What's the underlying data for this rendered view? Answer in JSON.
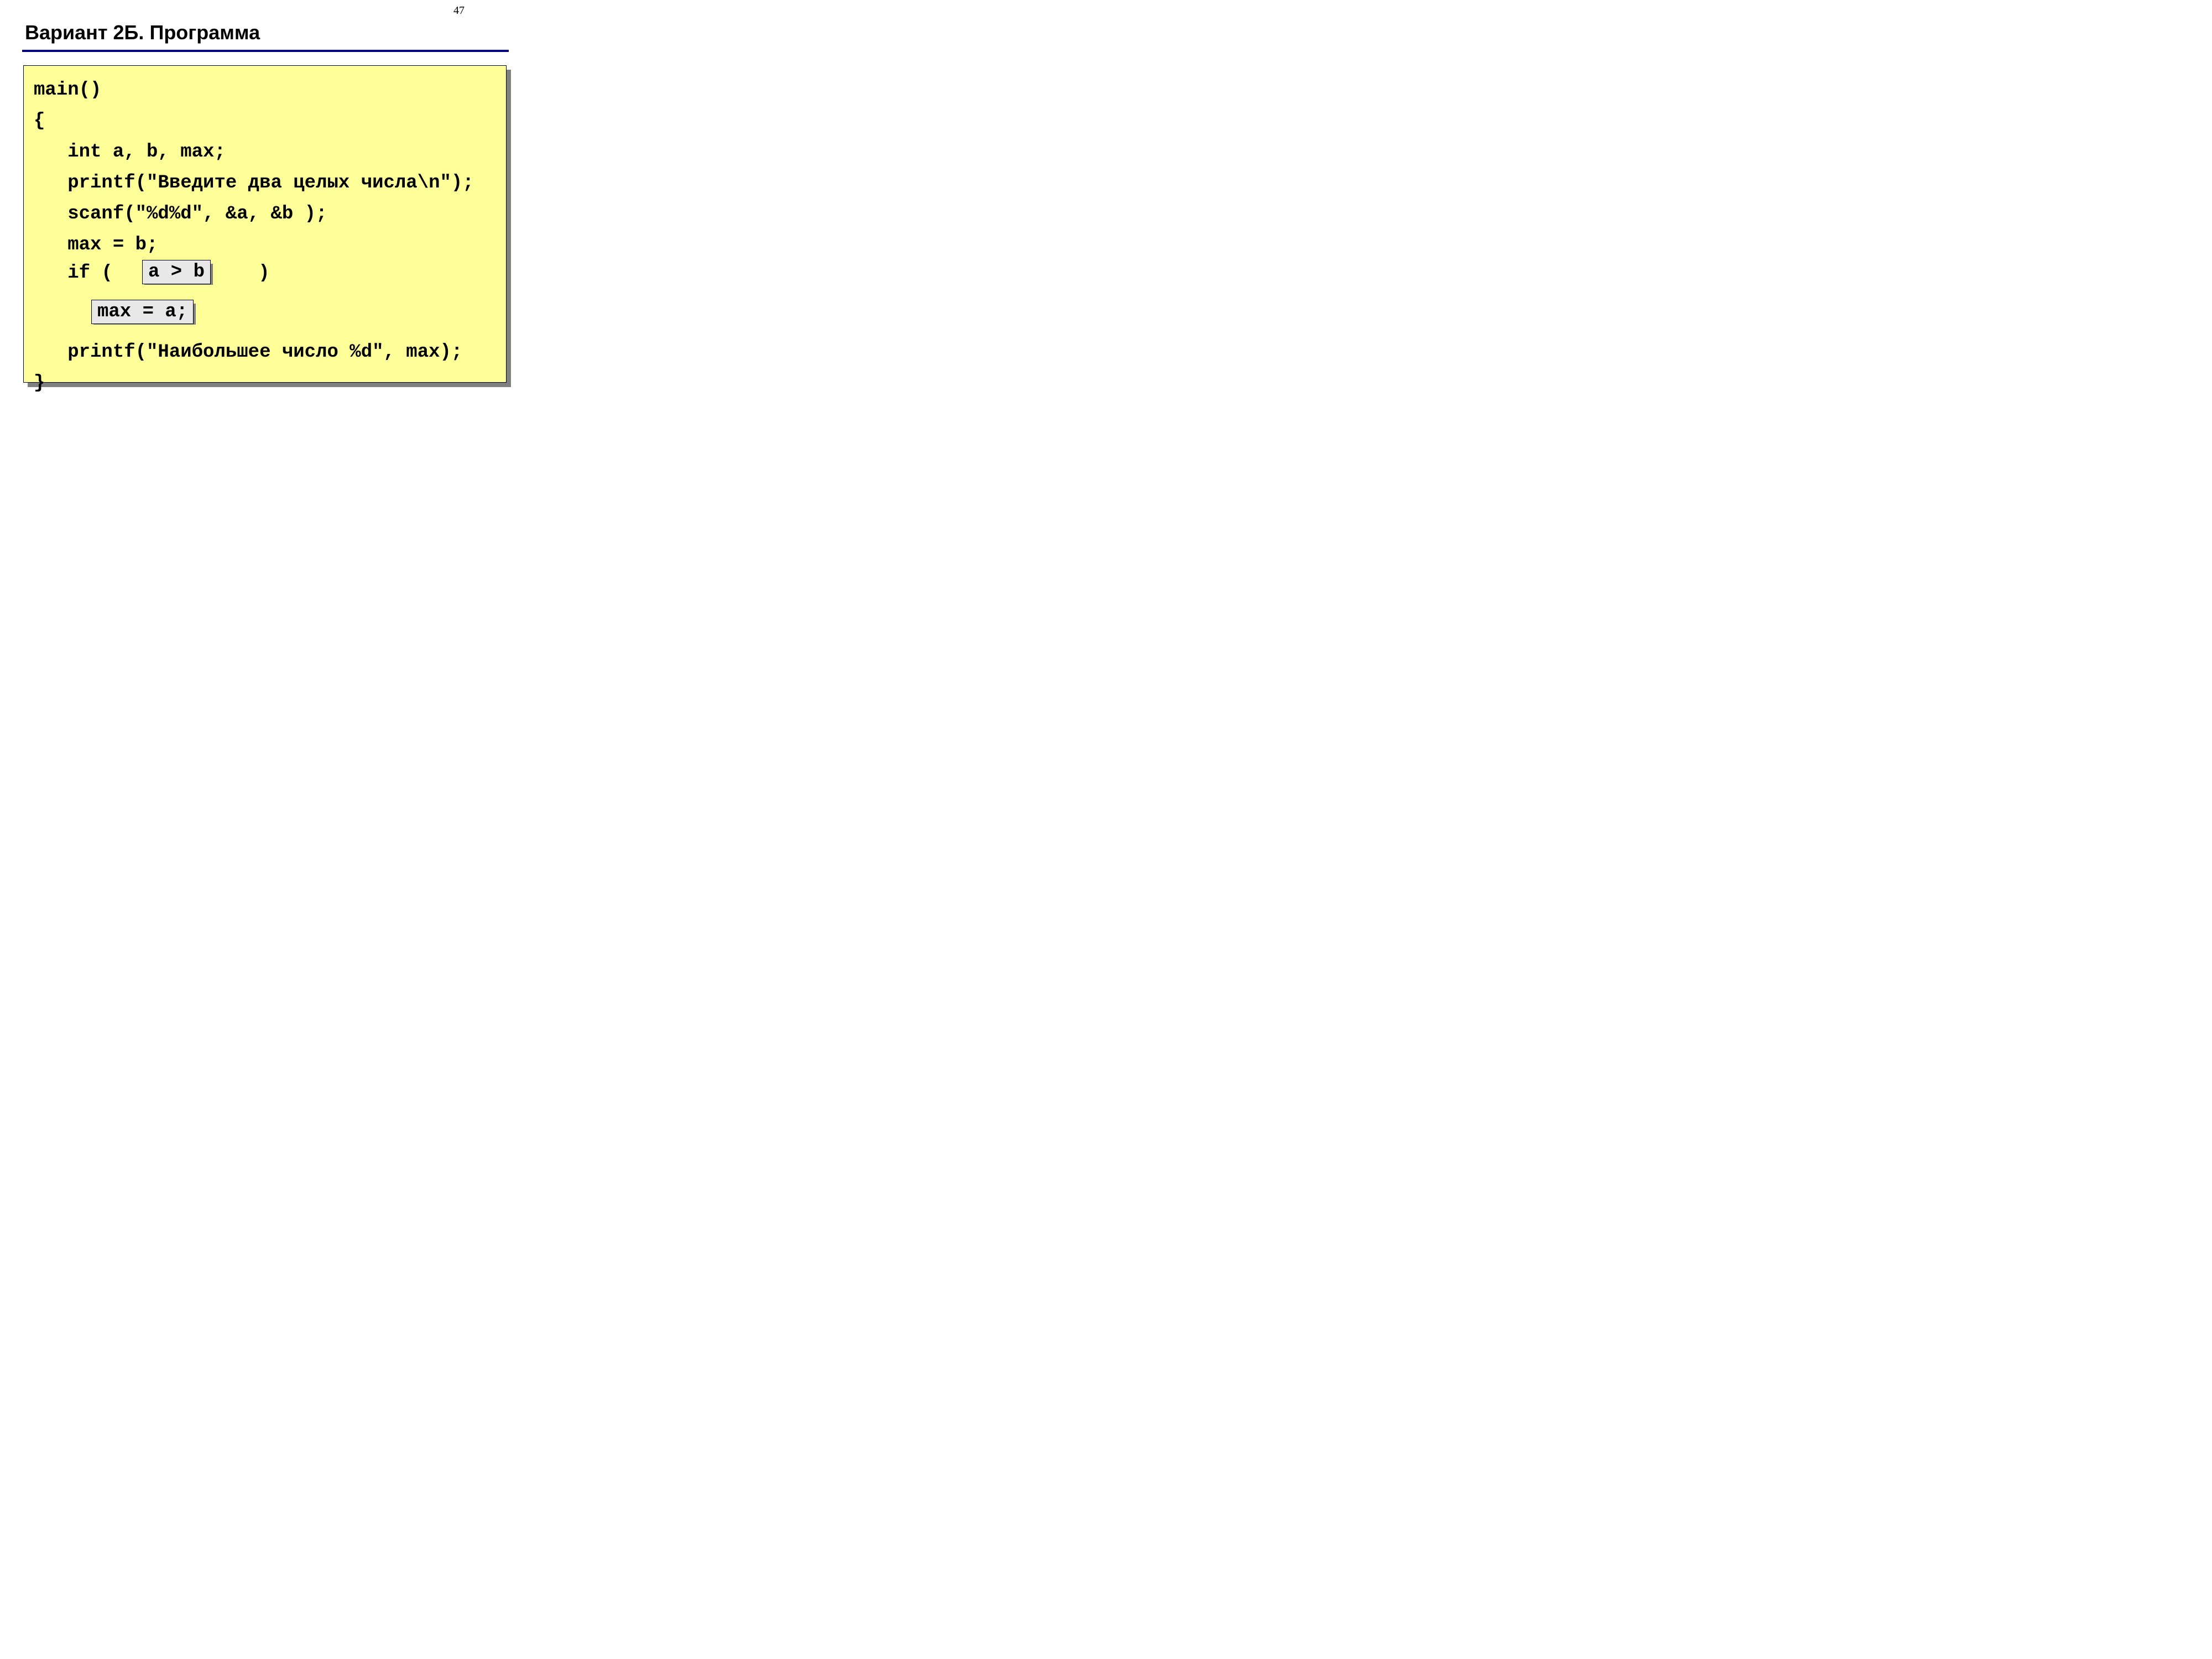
{
  "page_number": "47",
  "title": "Вариант 2Б. Программа",
  "code": {
    "l1": "main()",
    "l2": "{",
    "l3": "   int a, b, max;",
    "l4": "   printf(\"Введите два целых числа\\n\");",
    "l5": "   scanf(\"%d%d\", &a, &b );",
    "l6": "   max = b;",
    "l7_left": "   if ( ",
    "l7_right": "   )",
    "condition_box": "a > b",
    "assign_box": "max = a;",
    "l9": "   printf(\"Наибольшее число %d\", max);",
    "l10": "}"
  }
}
